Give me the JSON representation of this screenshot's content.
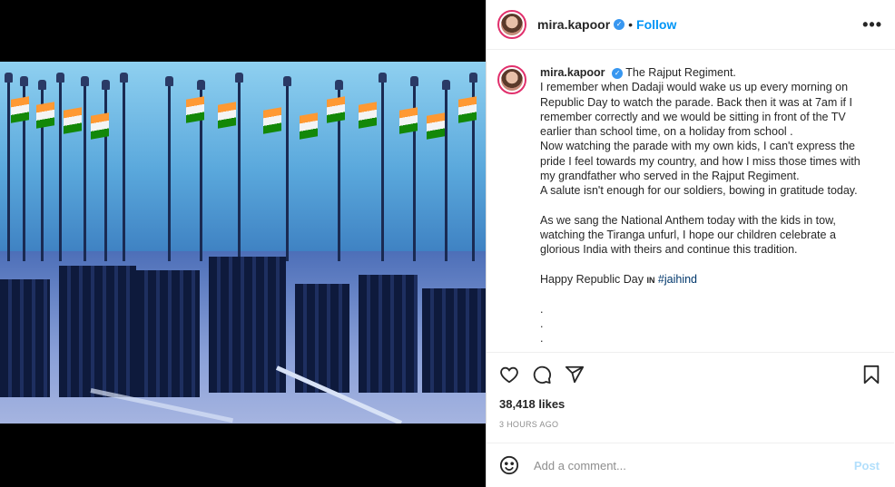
{
  "post": {
    "username": "mira.kapoor",
    "verified_icon": "verified-badge-icon",
    "separator": "•",
    "follow_label": "Follow",
    "more_label": "•••"
  },
  "caption": {
    "title": "The Rajput Regiment.",
    "p1": "I remember when Dadaji would wake us up every morning on Republic Day to watch the parade. Back then it was at 7am if I remember correctly and we would be sitting in front of the TV earlier than school time, on a holiday from school .",
    "p2": "Now watching the parade with my own kids, I can't express the pride I feel towards my country, and how I miss those times with my grandfather who served in the Rajput Regiment.",
    "p3": "A salute isn't enough for our soldiers, bowing in gratitude today.",
    "p4": "As we sang the National Anthem today with the kids in tow, watching the Tiranga unfurl, I hope our children celebrate a glorious India with theirs and continue this tradition.",
    "p5_text": "Happy Republic Day",
    "p5_in": "IN",
    "p5_hashtag": "#jaihind",
    "dots": [
      ".",
      ".",
      "."
    ]
  },
  "actions": {
    "likes": "38,418 likes",
    "time_ago": "3 HOURS AGO"
  },
  "comment": {
    "placeholder": "Add a comment...",
    "post_label": "Post"
  },
  "colors": {
    "accent": "#0095f6",
    "post_disabled": "#b2dffc",
    "hashtag": "#00376b"
  }
}
